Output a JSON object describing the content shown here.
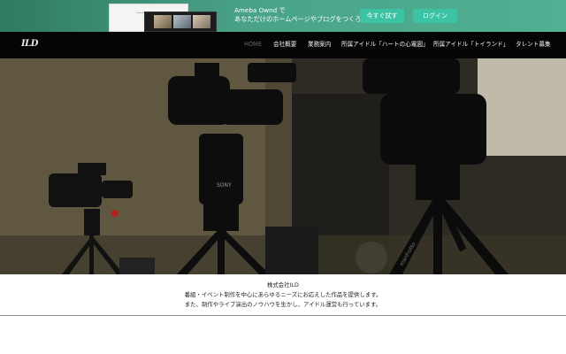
{
  "promo": {
    "line1": "Ameba Ownd で",
    "line2": "あなただけのホームページやブログをつくろう",
    "try_label": "今すぐ試す",
    "login_label": "ログイン",
    "accent": "#3cc3a3"
  },
  "site": {
    "logo": "ILD"
  },
  "nav": {
    "items": [
      {
        "label": "HOME"
      },
      {
        "label": "会社概要"
      },
      {
        "label": "業務案内"
      },
      {
        "label": "所属アイドル「ハートの心電図」"
      },
      {
        "label": "所属アイドル「トイランド」"
      },
      {
        "label": "タレント募集"
      }
    ]
  },
  "intro": {
    "company": "株式会社ILD",
    "line1": "番組・イベント制作を中心にあらゆるニーズにお応えした作品を提供します。",
    "line2": "また、制作やライブ演出のノウハウを生かし、アイドル運営も行っています。"
  }
}
